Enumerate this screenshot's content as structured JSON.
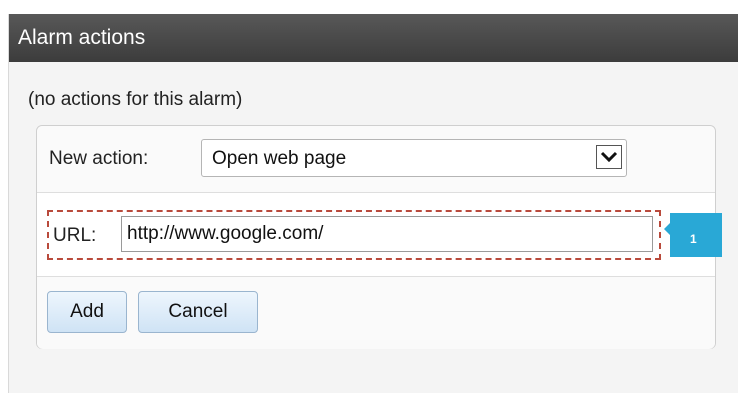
{
  "dialog": {
    "title": "Alarm actions",
    "no_actions_text": "(no actions for this alarm)"
  },
  "new_action": {
    "label": "New action:",
    "selected_value": "Open web page"
  },
  "url_field": {
    "label": "URL:",
    "value": "http://www.google.com/"
  },
  "buttons": {
    "add_label": "Add",
    "cancel_label": "Cancel"
  },
  "annotation": {
    "callout_number": "1",
    "callout_color": "#29A8D6",
    "highlight_color": "#B94A3C"
  },
  "icons": {
    "dropdown": "chevron-down-icon"
  }
}
